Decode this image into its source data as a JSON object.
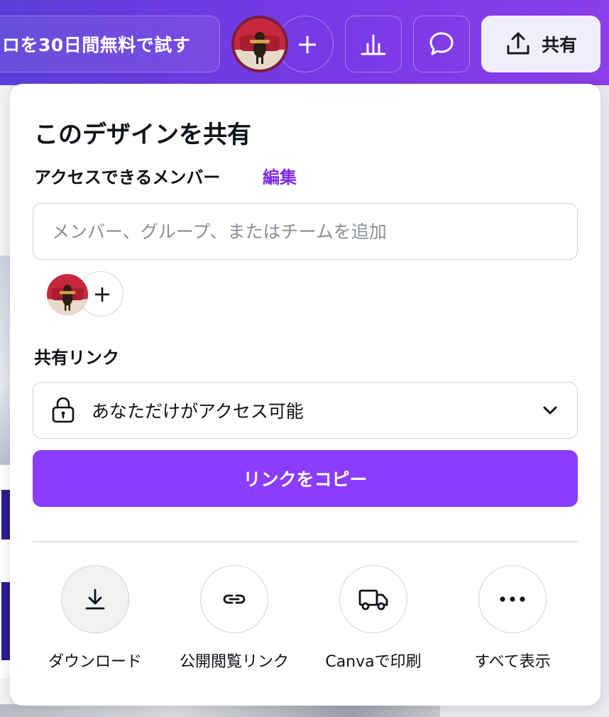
{
  "topbar": {
    "trial_label": "ロを30日間無料で試す",
    "add_collaborator": "+",
    "share_label": "共有"
  },
  "share_panel": {
    "title": "このデザインを共有",
    "members_label": "アクセスできるメンバー",
    "edit_label": "編集",
    "member_input_placeholder": "メンバー、グループ、またはチームを追加",
    "add_member": "+",
    "share_link_label": "共有リンク",
    "access_value": "あなただけがアクセス可能",
    "copy_link_label": "リンクをコピー",
    "actions": [
      {
        "label": "ダウンロード",
        "icon": "download-icon"
      },
      {
        "label": "公開閲覧リンク",
        "icon": "link-icon"
      },
      {
        "label": "Canvaで印刷",
        "icon": "truck-icon"
      },
      {
        "label": "すべて表示",
        "icon": "more-icon"
      }
    ]
  },
  "colors": {
    "topbar_gradient_start": "#5b3fd8",
    "topbar_gradient_end": "#8a3fe8",
    "accent": "#8b3dff",
    "edit_link": "#7d2ae8"
  }
}
